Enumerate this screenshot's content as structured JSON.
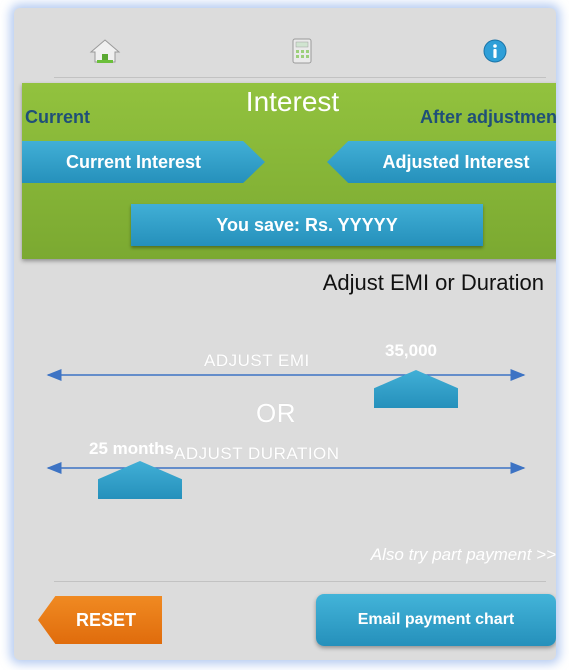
{
  "nav": {
    "icons": [
      "home-icon",
      "calculator-icon",
      "info-icon"
    ]
  },
  "interest": {
    "title": "Interest",
    "current_heading": "Current",
    "after_heading": "After adjustment",
    "current_interest_label": "Current Interest",
    "adjusted_interest_label": "Adjusted Interest",
    "savings_text": "You save: Rs. YYYYY"
  },
  "adjust": {
    "heading": "Adjust EMI or Duration",
    "emi_label": "ADJUST EMI",
    "emi_value": "35,000",
    "or_text": "OR",
    "duration_label": "ADJUST DURATION",
    "duration_value": "25 months"
  },
  "links": {
    "part_payment": "Also try part payment >>"
  },
  "buttons": {
    "reset": "RESET",
    "email_chart": "Email payment chart"
  },
  "colors": {
    "panel_green": "#8ab938",
    "button_blue": "#2e9fcb",
    "reset_orange": "#e8780f",
    "heading_navy": "#1f4f78"
  }
}
